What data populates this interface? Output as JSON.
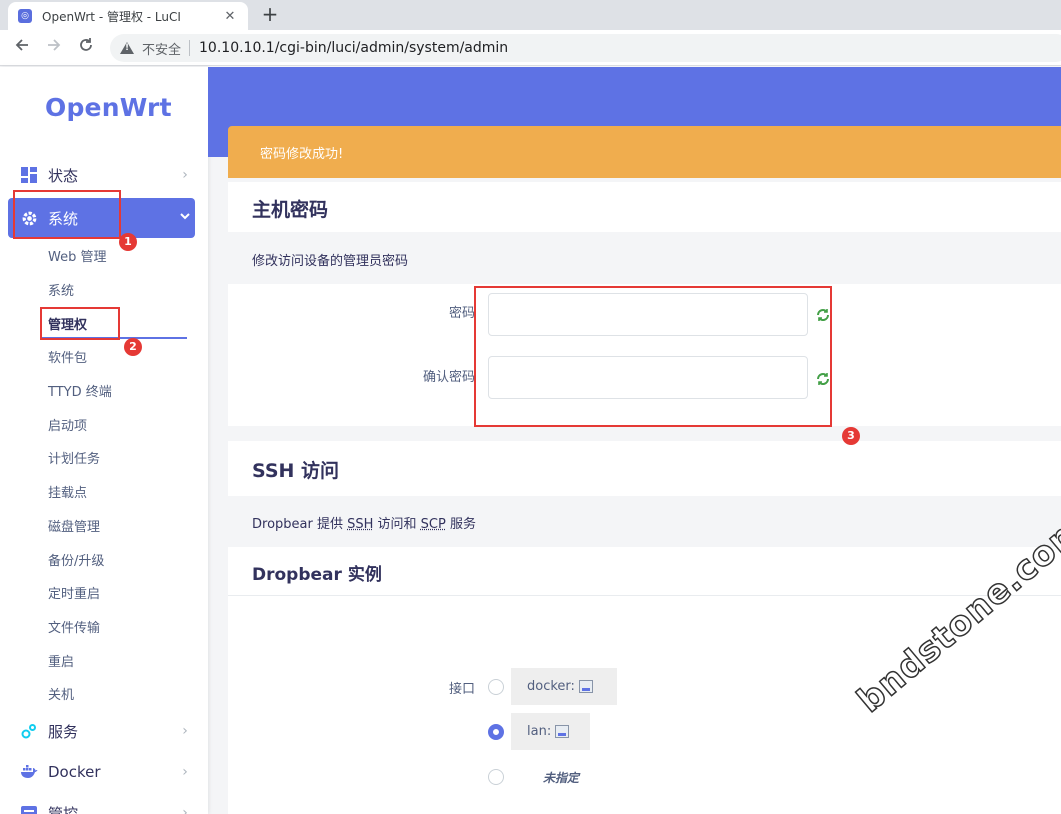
{
  "browser": {
    "tab_title": "OpenWrt - 管理权 - LuCI",
    "tab_close": "✕",
    "new_tab": "+",
    "insecure_label": "不安全",
    "url": "10.10.10.1/cgi-bin/luci/admin/system/admin"
  },
  "sidebar": {
    "logo": "OpenWrt",
    "menu": [
      {
        "label": "状态",
        "icon": "dashboard-icon"
      },
      {
        "label": "系统",
        "icon": "gear-icon",
        "active": true
      },
      {
        "label": "服务",
        "icon": "services-icon"
      },
      {
        "label": "Docker",
        "icon": "docker-icon"
      },
      {
        "label": "管控",
        "icon": "control-icon"
      }
    ],
    "submenu": [
      "Web 管理",
      "系统",
      "管理权",
      "软件包",
      "TTYD 终端",
      "启动项",
      "计划任务",
      "挂载点",
      "磁盘管理",
      "备份/升级",
      "定时重启",
      "文件传输",
      "重启",
      "关机"
    ]
  },
  "annotations": [
    "1",
    "2",
    "3"
  ],
  "alert": {
    "message": "密码修改成功!"
  },
  "host_password": {
    "title": "主机密码",
    "description": "修改访问设备的管理员密码",
    "password_label": "密码",
    "confirm_label": "确认密码"
  },
  "ssh": {
    "title": "SSH 访问",
    "desc_prefix": "Dropbear 提供 ",
    "desc_ssh": "SSH",
    "desc_mid": " 访问和 ",
    "desc_scp": "SCP",
    "desc_suffix": " 服务"
  },
  "dropbear": {
    "title": "Dropbear 实例",
    "interface_label": "接口",
    "interfaces": [
      {
        "label": "docker:",
        "checked": false
      },
      {
        "label": "lan:",
        "checked": true
      }
    ],
    "unspecified": "未指定"
  },
  "watermark": "bndstone.com",
  "colors": {
    "accent": "#5e72e4",
    "alert": "#f0ad4e",
    "annotation": "#e53935"
  }
}
